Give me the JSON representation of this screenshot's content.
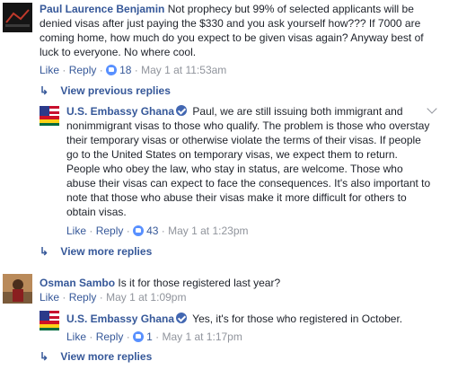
{
  "comment1": {
    "author": "Paul Laurence Benjamin",
    "text": "Not prophecy but 99% of selected applicants will be denied visas after just paying the $330 and you ask yourself how??? If 7000 are coming home, how much do you expect to be given visas again? Anyway best of luck to everyone. No where cool.",
    "like_label": "Like",
    "reply_label": "Reply",
    "likes": "18",
    "time": "May 1 at 11:53am"
  },
  "prev_replies": {
    "label": "View previous replies"
  },
  "reply1": {
    "author": "U.S. Embassy Ghana",
    "text": "Paul, we are still issuing both immigrant and nonimmigrant visas to those who qualify. The problem is those who overstay their temporary visas or otherwise violate the terms of their visas. If people go to the United States on temporary visas, we expect them to return. People who obey the law, who stay in status, are welcome. Those who abuse their visas can expect to face the consequences. It's also important to note that those who abuse their visas make it more difficult for others to obtain visas.",
    "like_label": "Like",
    "reply_label": "Reply",
    "likes": "43",
    "time": "May 1 at 1:23pm"
  },
  "more_replies1": {
    "label": "View more replies"
  },
  "comment2": {
    "author": "Osman Sambo",
    "text": "Is it for those registered last year?",
    "like_label": "Like",
    "reply_label": "Reply",
    "time": "May 1 at 1:09pm"
  },
  "reply2": {
    "author": "U.S. Embassy Ghana",
    "text": "Yes, it's for those who registered in October.",
    "like_label": "Like",
    "reply_label": "Reply",
    "likes": "1",
    "time": "May 1 at 1:17pm"
  },
  "more_replies2": {
    "label": "View more replies"
  },
  "colors": {
    "link": "#365899",
    "muted": "#90949c",
    "like": "#5890ff"
  }
}
